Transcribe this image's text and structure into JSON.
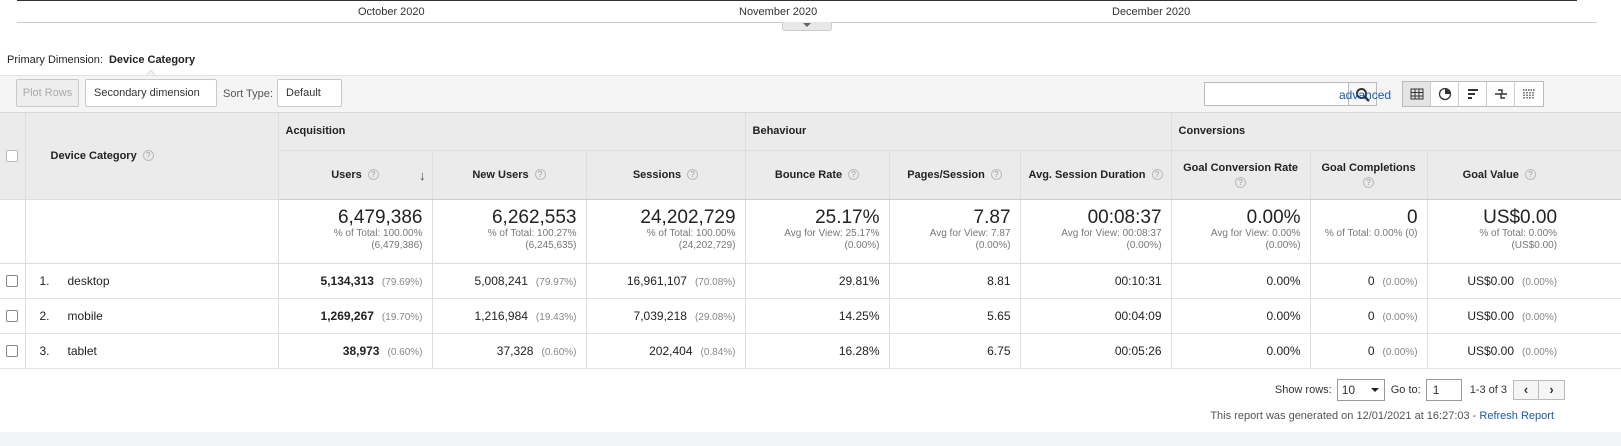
{
  "timeline": {
    "months": [
      "October 2020",
      "November 2020",
      "December 2020"
    ]
  },
  "primary_dimension": {
    "label": "Primary Dimension:",
    "value": "Device Category"
  },
  "toolbar": {
    "plot_rows": "Plot Rows",
    "secondary_dimension": "Secondary dimension",
    "sort_type_label": "Sort Type:",
    "sort_type_value": "Default",
    "search_placeholder": "",
    "advanced": "advanced"
  },
  "table": {
    "dimension_header": "Device Category",
    "groups": [
      "Acquisition",
      "Behaviour",
      "Conversions"
    ],
    "columns": [
      "Users",
      "New Users",
      "Sessions",
      "Bounce Rate",
      "Pages/Session",
      "Avg. Session Duration",
      "Goal Conversion Rate",
      "Goal Completions",
      "Goal Value"
    ],
    "totals": [
      {
        "value": "6,479,386",
        "sub1": "% of Total: 100.00%",
        "sub2": "(6,479,386)"
      },
      {
        "value": "6,262,553",
        "sub1": "% of Total: 100.27%",
        "sub2": "(6,245,635)"
      },
      {
        "value": "24,202,729",
        "sub1": "% of Total: 100.00%",
        "sub2": "(24,202,729)"
      },
      {
        "value": "25.17%",
        "sub1": "Avg for View: 25.17%",
        "sub2": "(0.00%)"
      },
      {
        "value": "7.87",
        "sub1": "Avg for View: 7.87",
        "sub2": "(0.00%)"
      },
      {
        "value": "00:08:37",
        "sub1": "Avg for View: 00:08:37",
        "sub2": "(0.00%)"
      },
      {
        "value": "0.00%",
        "sub1": "Avg for View: 0.00%",
        "sub2": "(0.00%)"
      },
      {
        "value": "0",
        "sub1": "% of Total: 0.00% (0)",
        "sub2": ""
      },
      {
        "value": "US$0.00",
        "sub1": "% of Total: 0.00%",
        "sub2": "(US$0.00)"
      }
    ],
    "rows": [
      {
        "rank": "1.",
        "label": "desktop",
        "users": "5,134,313",
        "users_pct": "(79.69%)",
        "new_users": "5,008,241",
        "new_users_pct": "(79.97%)",
        "sessions": "16,961,107",
        "sessions_pct": "(70.08%)",
        "bounce_rate": "29.81%",
        "pages_session": "8.81",
        "avg_duration": "00:10:31",
        "conv_rate": "0.00%",
        "completions": "0",
        "completions_pct": "(0.00%)",
        "goal_value": "US$0.00",
        "goal_value_pct": "(0.00%)"
      },
      {
        "rank": "2.",
        "label": "mobile",
        "users": "1,269,267",
        "users_pct": "(19.70%)",
        "new_users": "1,216,984",
        "new_users_pct": "(19.43%)",
        "sessions": "7,039,218",
        "sessions_pct": "(29.08%)",
        "bounce_rate": "14.25%",
        "pages_session": "5.65",
        "avg_duration": "00:04:09",
        "conv_rate": "0.00%",
        "completions": "0",
        "completions_pct": "(0.00%)",
        "goal_value": "US$0.00",
        "goal_value_pct": "(0.00%)"
      },
      {
        "rank": "3.",
        "label": "tablet",
        "users": "38,973",
        "users_pct": "(0.60%)",
        "new_users": "37,328",
        "new_users_pct": "(0.60%)",
        "sessions": "202,404",
        "sessions_pct": "(0.84%)",
        "bounce_rate": "16.28%",
        "pages_session": "6.75",
        "avg_duration": "00:05:26",
        "conv_rate": "0.00%",
        "completions": "0",
        "completions_pct": "(0.00%)",
        "goal_value": "US$0.00",
        "goal_value_pct": "(0.00%)"
      }
    ]
  },
  "pagination": {
    "show_rows_label": "Show rows:",
    "show_rows_value": "10",
    "goto_label": "Go to:",
    "goto_value": "1",
    "range": "1-3 of 3",
    "prev": "‹",
    "next": "›"
  },
  "footer": {
    "generated_text": "This report was generated on 12/01/2021 at 16:27:03 -",
    "refresh_link": "Refresh Report"
  },
  "colors": {
    "link": "#1a5aa8",
    "header_bg": "#ebebeb",
    "toolbar_bg": "#f5f5f5"
  },
  "icons": [
    "search-icon",
    "table-view-icon",
    "pie-view-icon",
    "bar-view-icon",
    "comparison-view-icon",
    "pivot-view-icon",
    "sort-desc-arrow-icon",
    "help-icon"
  ]
}
